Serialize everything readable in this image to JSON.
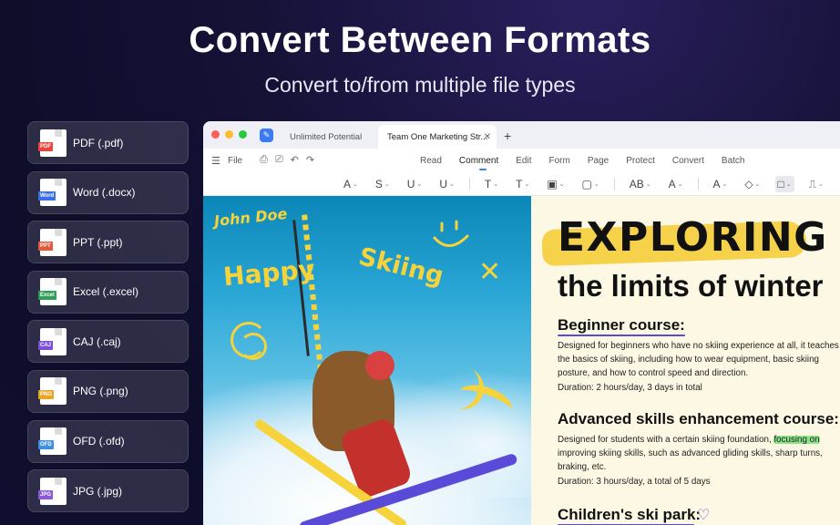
{
  "hero": {
    "title": "Convert Between Formats",
    "subtitle": "Convert to/from multiple file types"
  },
  "formats": [
    {
      "label": "PDF (.pdf)",
      "tag": "PDF",
      "color": "#e5453b"
    },
    {
      "label": "Word (.docx)",
      "tag": "Word",
      "color": "#3b6fe5"
    },
    {
      "label": "PPT (.ppt)",
      "tag": "PPT",
      "color": "#e5593b"
    },
    {
      "label": "Excel (.excel)",
      "tag": "Excel",
      "color": "#2f9e56"
    },
    {
      "label": "CAJ (.caj)",
      "tag": "CAJ",
      "color": "#7b4fd6"
    },
    {
      "label": "PNG (.png)",
      "tag": "PNG",
      "color": "#e9a524"
    },
    {
      "label": "OFD (.ofd)",
      "tag": "OFD",
      "color": "#3b8fe5"
    },
    {
      "label": "JPG (.jpg)",
      "tag": "JPG",
      "color": "#8a5ad6"
    }
  ],
  "window": {
    "tabs": [
      {
        "label": "Unlimited Potential"
      },
      {
        "label": "Team One Marketing Str..."
      }
    ],
    "file_label": "File",
    "menu": [
      "Read",
      "Comment",
      "Edit",
      "Form",
      "Page",
      "Protect",
      "Convert",
      "Batch"
    ],
    "active_menu": "Comment"
  },
  "toolbar_tools": [
    {
      "name": "highlight-tool",
      "glyph": "A"
    },
    {
      "name": "strikethrough-tool",
      "glyph": "S"
    },
    {
      "name": "underline-tool",
      "glyph": "U"
    },
    {
      "name": "squiggly-tool",
      "glyph": "U"
    },
    {
      "name": "text-tool",
      "glyph": "T"
    },
    {
      "name": "textbox-tool",
      "glyph": "T"
    },
    {
      "name": "note-tool",
      "glyph": "▣"
    },
    {
      "name": "callout-tool",
      "glyph": "▢"
    },
    {
      "name": "ab-tool",
      "glyph": "AB"
    },
    {
      "name": "font-color-tool",
      "glyph": "A"
    },
    {
      "name": "stamp-tool",
      "glyph": "A"
    },
    {
      "name": "eraser-tool",
      "glyph": "◇"
    },
    {
      "name": "shape-tool",
      "glyph": "□"
    },
    {
      "name": "signature-tool",
      "glyph": "⎍"
    }
  ],
  "photo": {
    "handwriting_name": "John Doe",
    "handwriting_happy": "Happy",
    "handwriting_skiing": "Skiing"
  },
  "document": {
    "heading_1": "EXPLORING",
    "heading_2": "the limits of winter",
    "sections": [
      {
        "title": "Beginner course:",
        "body": "Designed for beginners who have no skiing experience at all, it teaches the basics of skiing, including how to wear equipment, basic skiing posture, and how to control speed and direction.",
        "duration": "Duration: 2 hours/day, 3 days in total"
      },
      {
        "title": "Advanced skills enhancement course:",
        "body_before": "Designed for students with a certain skiing foundation, ",
        "highlight": "focusing on",
        "body_after": " improving skiing skills, such as advanced gliding skills, sharp turns, braking, etc.",
        "duration": "Duration: 3 hours/day, a total of 5 days"
      },
      {
        "title": "Children's ski park:"
      }
    ]
  },
  "colors": {
    "accent": "#3b7bf6",
    "highlight_yellow": "#f6d24a",
    "highlight_green": "#8be48a",
    "ink_purple": "#5a4ad8"
  }
}
